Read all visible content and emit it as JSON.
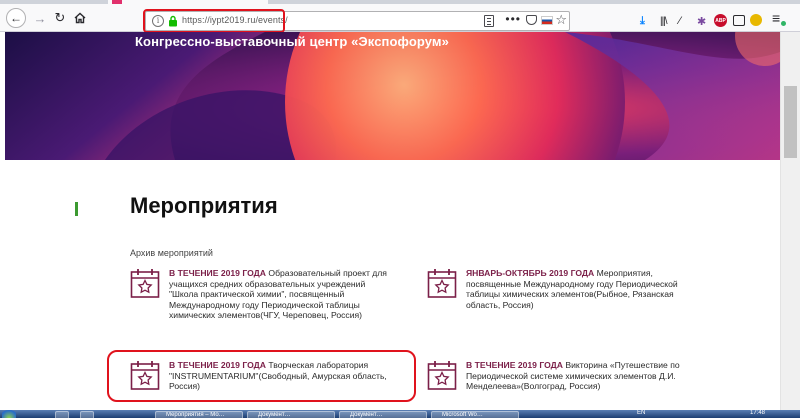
{
  "browser": {
    "url": "https://iypt2019.ru/events/",
    "colors": {
      "highlight": "#e0131d"
    }
  },
  "hero": {
    "title": "Конгрессно-выставочный центр «Экспофорум»"
  },
  "main": {
    "title": "Мероприятия",
    "section_label": "Архив мероприятий",
    "accent_color": "#7b1f48",
    "events": [
      {
        "date": "В ТЕЧЕНИЕ 2019 ГОДА",
        "text": " Образовательный проект для учащихся средних образовательных учреждений \"Школа практической химии\", посвященный Международному году Периодической таблицы химических элементов(ЧГУ, Череповец, Россия)",
        "icon": "calendar-star-icon"
      },
      {
        "date": "ЯНВАРЬ-ОКТЯБРЬ 2019 ГОДА",
        "text": " Мероприятия, посвященные Международному году Периодической таблицы химических элементов(Рыбное, Рязанская область, Россия)",
        "icon": "calendar-star-icon"
      },
      {
        "date": "В ТЕЧЕНИЕ 2019 ГОДА",
        "text": " Творческая лаборатория \"INSTRUMENTARIUM\"(Свободный, Амурская область, Россия)",
        "icon": "calendar-star-icon"
      },
      {
        "date": "В ТЕЧЕНИЕ 2019 ГОДА",
        "text": " Викторина «Путешествие по Периодической системе химических элементов Д.И. Менделеева»(Волгоград, Россия)",
        "icon": "calendar-star-icon"
      }
    ]
  },
  "taskbar": {
    "items": [
      {
        "label": "",
        "icon": "explorer-icon"
      },
      {
        "label": "",
        "icon": "firefox-icon"
      },
      {
        "label": "Мероприятия – Мо…",
        "icon": "firefox-icon"
      },
      {
        "label": "Документ…",
        "icon": "word-icon"
      },
      {
        "label": "Документ…",
        "icon": "word-icon"
      },
      {
        "label": "Microsoft Wo…",
        "icon": "word-icon"
      }
    ],
    "lang": "EN",
    "clock": "17:48"
  }
}
